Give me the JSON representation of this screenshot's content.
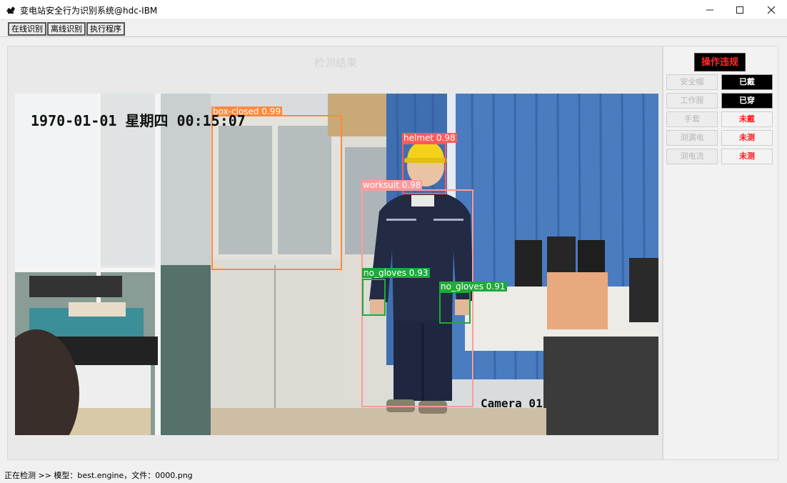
{
  "window": {
    "title": "变电站安全行为识别系统@hdc-IBM",
    "icons": [
      "app-icon",
      "minimize-icon",
      "maximize-icon",
      "close-icon"
    ]
  },
  "toolbar": {
    "buttons": [
      {
        "label": "在线识别"
      },
      {
        "label": "离线识别"
      },
      {
        "label": "执行程序"
      }
    ]
  },
  "main": {
    "title": "检测结果",
    "frame": {
      "timestamp": "1970-01-01 星期四 00:15:07",
      "camera": "Camera 01",
      "detections": [
        {
          "label": "box-closed 0.99",
          "color": "#ff8a3d"
        },
        {
          "label": "helmet 0.98",
          "color": "#ff5a5a"
        },
        {
          "label": "worksuit 0.98",
          "color": "#ff9a9a"
        },
        {
          "label": "no_gloves 0.93",
          "color": "#1faa3a"
        },
        {
          "label": "no_gloves 0.91",
          "color": "#1faa3a"
        }
      ]
    }
  },
  "side": {
    "violation": "操作违规",
    "items": [
      {
        "label": "安全帽",
        "value": "已戴",
        "state": "ok"
      },
      {
        "label": "工作服",
        "value": "已穿",
        "state": "ok"
      },
      {
        "label": "手套",
        "value": "未戴",
        "state": "bad"
      },
      {
        "label": "测漏电",
        "value": "未测",
        "state": "bad"
      },
      {
        "label": "测电流",
        "value": "未测",
        "state": "bad"
      }
    ],
    "colors": {
      "ok_bg": "#000000",
      "ok_text": "#ffffff",
      "bad_text": "#ff1a1a",
      "violation_text": "#ff2a2a"
    }
  },
  "status": {
    "text": "正在检测 >> 模型：best.engine，文件：0000.png"
  }
}
